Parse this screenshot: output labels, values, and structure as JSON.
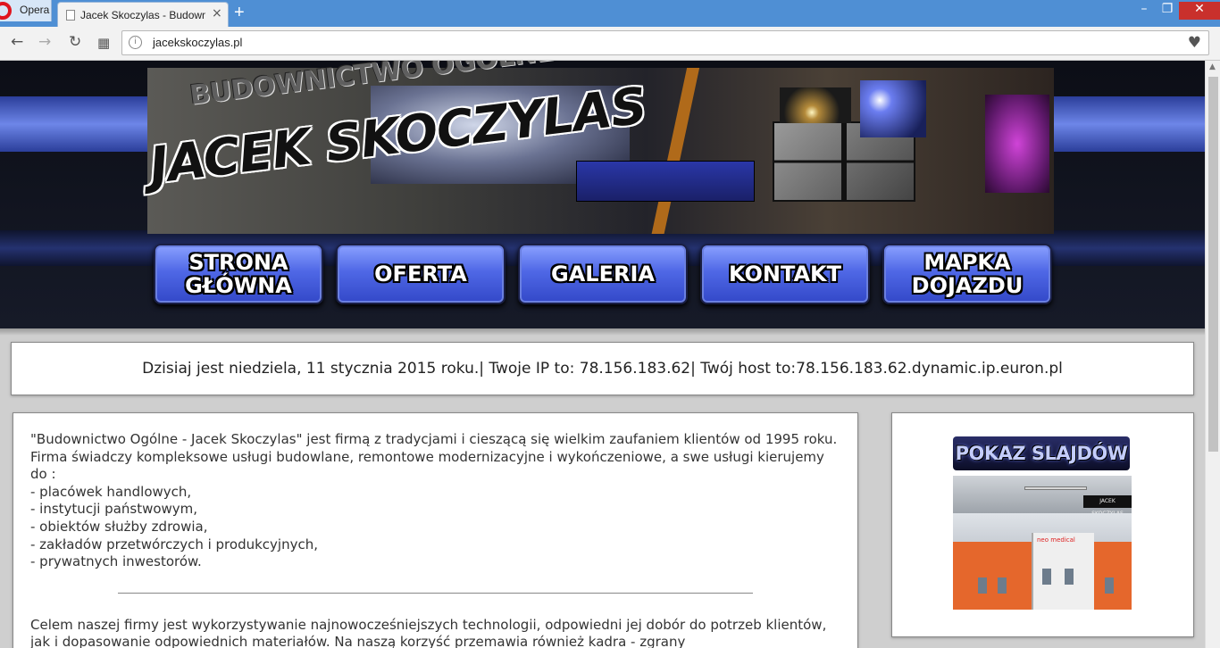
{
  "browser": {
    "menu_label": "Opera",
    "tab_title": "Jacek Skoczylas - Budownictwo Ogólne",
    "new_tab": "+",
    "tab_close": "×",
    "url": "jacekskoczylas.pl",
    "window_controls": {
      "minimize": "–",
      "maximize": "❐",
      "close": "✕"
    },
    "nav_icons": {
      "back": "←",
      "forward": "→",
      "reload": "↻",
      "speed_dial": "▦",
      "info": "i",
      "bookmark": "♥"
    }
  },
  "header": {
    "logo_top": "BUDOWNICTWO OGÓLNE",
    "logo_main": "JACEK SKOCZYLAS",
    "menu": [
      {
        "label_line1": "STRONA",
        "label_line2": "GŁÓWNA"
      },
      {
        "label_line1": "OFERTA",
        "label_line2": ""
      },
      {
        "label_line1": "GALERIA",
        "label_line2": ""
      },
      {
        "label_line1": "KONTAKT",
        "label_line2": ""
      },
      {
        "label_line1": "MAPKA",
        "label_line2": "DOJAZDU"
      }
    ]
  },
  "datebar": {
    "text": "Dzisiaj jest niedziela, 11 stycznia 2015 roku.| Twoje IP to: 78.156.183.62| Twój host to:78.156.183.62.dynamic.ip.euron.pl"
  },
  "content": {
    "intro": "\"Budownictwo Ogólne - Jacek Skoczylas\" jest firmą z tradycjami i cieszącą się wielkim zaufaniem klientów od 1995 roku. Firma świadczy kompleksowe usługi budowlane, remontowe modernizacyjne i wykończeniowe, a swe usługi kierujemy do :",
    "list": [
      "- placówek handlowych,",
      "- instytucji państwowym,",
      "- obiektów służby zdrowia,",
      "- zakładów przetwórczych i produkcyjnych,",
      "- prywatnych inwestorów."
    ],
    "second": "Celem naszej firmy jest wykorzystywanie najnowocześniejszych technologii, odpowiedni jej dobór do potrzeb klientów, jak i dopasowanie odpowiednich materiałów. Na naszą korzyść przemawia również kadra - zgrany"
  },
  "sidebar": {
    "slideshow_title": "POKAZ SLAJDÓW",
    "slide_brand": "JACEK SKOCZYLAS",
    "slide_sign": "neo medical"
  }
}
